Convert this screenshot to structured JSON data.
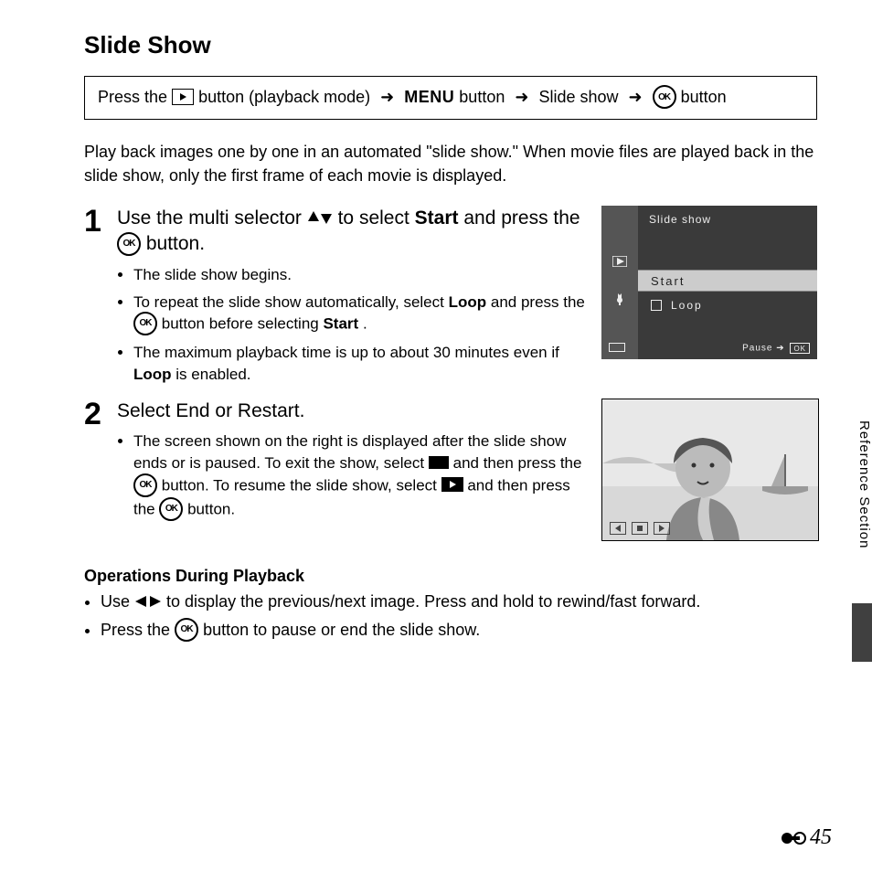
{
  "title": "Slide Show",
  "nav": {
    "press_the": "Press the ",
    "button_playback": " button (playback mode) ",
    "menu": "MENU",
    "button2": " button ",
    "slide_show": " Slide show ",
    "button3": " button"
  },
  "intro": "Play back images one by one in an automated \"slide show.\" When movie files are played back in the slide show, only the first frame of each movie is displayed.",
  "steps": {
    "s1": {
      "num": "1",
      "title_a": "Use the multi selector ",
      "title_b": " to select ",
      "title_start": "Start",
      "title_c": " and press the ",
      "title_d": " button.",
      "b1": "The slide show begins.",
      "b2a": "To repeat the slide show automatically, select ",
      "b2_loop": "Loop",
      "b2b": " and press the ",
      "b2c": " button before selecting ",
      "b2_start": "Start",
      "b2d": ".",
      "b3a": "The maximum playback time is up to about 30 minutes even if ",
      "b3_loop": "Loop",
      "b3b": " is enabled."
    },
    "s2": {
      "num": "2",
      "title": "Select End or Restart.",
      "b1a": "The screen shown on the right is displayed after the slide show ends or is paused. To exit the show, select ",
      "b1b": " and then press the ",
      "b1c": " button. To resume the slide show, select ",
      "b1d": " and then press the ",
      "b1e": " button."
    }
  },
  "lcd": {
    "head": "Slide show",
    "start": "Start",
    "loop": "Loop",
    "pause": "Pause"
  },
  "ops": {
    "title": "Operations During Playback",
    "l1a": "Use ",
    "l1b": " to display the previous/next image. Press and hold to rewind/fast forward.",
    "l2a": "Press the ",
    "l2b": " button to pause or end the slide show."
  },
  "side_tab": "Reference Section",
  "page_num": "45"
}
